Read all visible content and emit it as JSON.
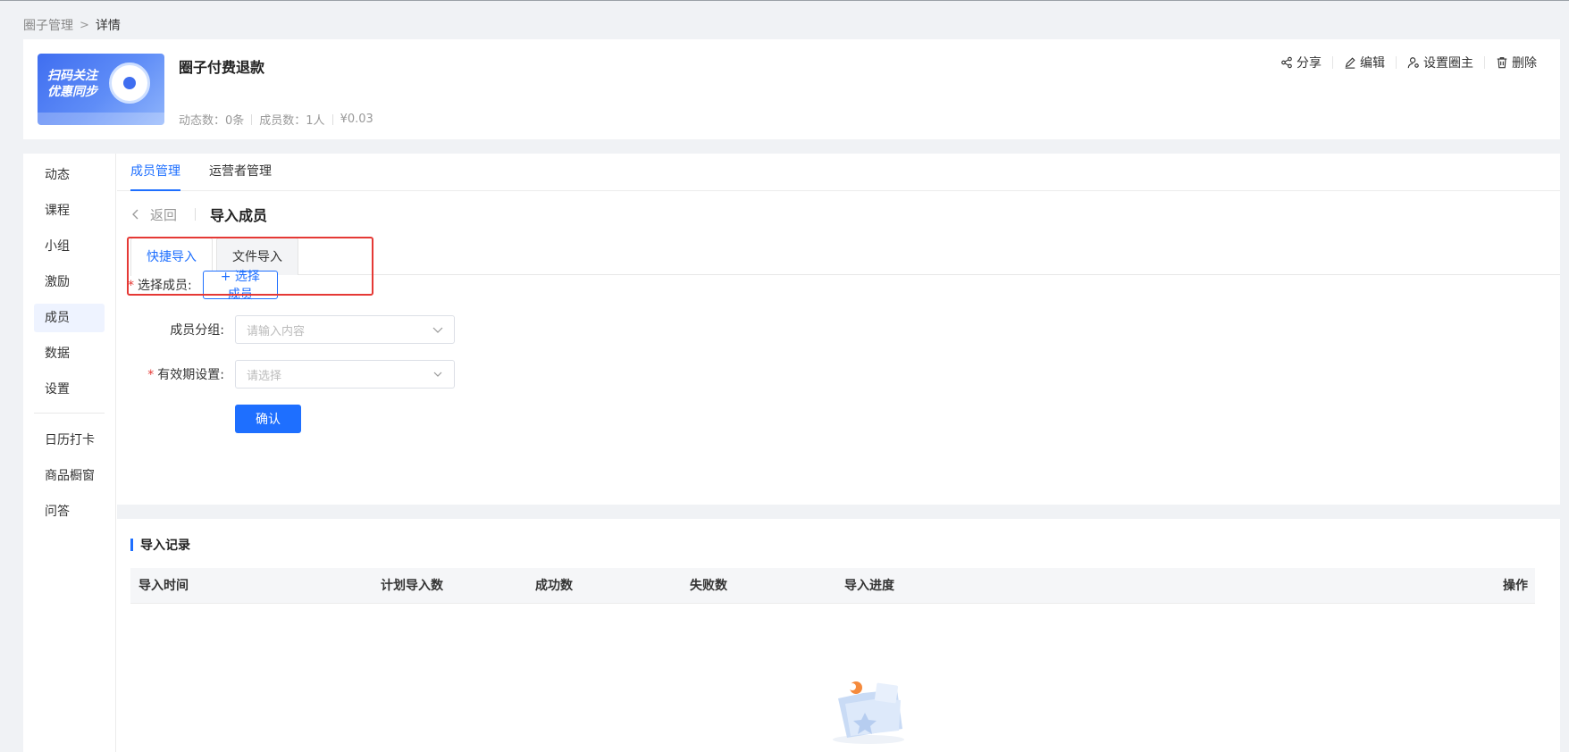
{
  "breadcrumb": {
    "parent": "圈子管理",
    "current": "详情"
  },
  "circle": {
    "cover_text_line1": "扫码关注",
    "cover_text_line2": "优惠同步",
    "title": "圈子付费退款",
    "stats": {
      "posts": "动态数：0条",
      "members": "成员数：1人",
      "price": "¥0.03"
    }
  },
  "header_actions": {
    "share": "分享",
    "edit": "编辑",
    "set_owner": "设置圈主",
    "delete": "删除"
  },
  "sidebar": {
    "items": [
      "动态",
      "课程",
      "小组",
      "激励",
      "成员",
      "数据",
      "设置"
    ],
    "extra_items": [
      "日历打卡",
      "商品橱窗",
      "问答"
    ],
    "active": "成员"
  },
  "top_tabs": [
    "成员管理",
    "运营者管理"
  ],
  "back": {
    "label": "返回",
    "title": "导入成员"
  },
  "import_tabs": [
    "快捷导入",
    "文件导入"
  ],
  "form": {
    "select_members": {
      "label": "选择成员:",
      "button": "+ 选择成员",
      "required": true
    },
    "group": {
      "label": "成员分组:",
      "placeholder": "请输入内容"
    },
    "validity": {
      "label": "有效期设置:",
      "placeholder": "请选择",
      "required": true
    },
    "confirm": "确认"
  },
  "records": {
    "title": "导入记录",
    "columns": [
      "导入时间",
      "计划导入数",
      "成功数",
      "失败数",
      "导入进度",
      "操作"
    ]
  },
  "colors": {
    "primary": "#1e6fff",
    "highlight": "#e53935"
  }
}
